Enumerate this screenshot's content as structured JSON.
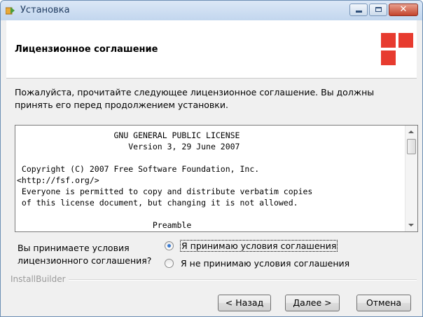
{
  "window": {
    "title": "Установка",
    "colors": {
      "accent": "#e73b2f",
      "title_bar": "#c2d6ee",
      "close_button": "#c4442c"
    },
    "icons": [
      "installer-app-icon",
      "minimize-icon",
      "maximize-icon",
      "close-icon"
    ]
  },
  "header": {
    "title": "Лицензионное соглашение"
  },
  "intro": {
    "text": "Пожалуйста, прочитайте следующее лицензионное соглашение. Вы должны принять его перед продолжением установки."
  },
  "license": {
    "text": "                    GNU GENERAL PUBLIC LICENSE\n                       Version 3, 29 June 2007\n\n Copyright (C) 2007 Free Software Foundation, Inc.\n<http://fsf.org/>\n Everyone is permitted to copy and distribute verbatim copies\n of this license document, but changing it is not allowed.\n\n                            Preamble"
  },
  "agreement": {
    "question": "Вы принимаете условия лицензионного соглашения?",
    "accept_label": "Я принимаю условия соглашения",
    "decline_label": "Я не принимаю условия соглашения",
    "selected": "accept"
  },
  "brand": {
    "text": "InstallBuilder"
  },
  "buttons": {
    "back": "< Назад",
    "next": "Далее >",
    "cancel": "Отмена"
  }
}
